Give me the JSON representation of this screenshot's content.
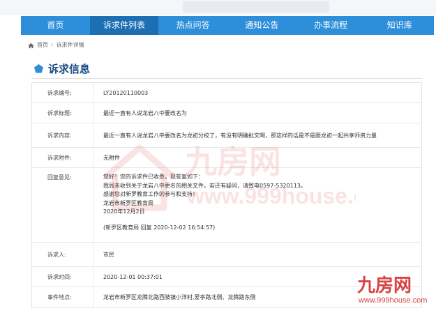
{
  "nav": {
    "items": [
      "首页",
      "诉求件列表",
      "热点问答",
      "通知公告",
      "办事流程",
      "知识库"
    ],
    "active_index": 1
  },
  "breadcrumb": {
    "home": "首页",
    "current": "诉求件详情"
  },
  "section_title": "诉求信息",
  "fields": {
    "code_label": "诉求编号:",
    "code_value": "LY20120110003",
    "title_label": "诉求标题:",
    "title_value": "最近一直有人说龙岩八中要改名为",
    "content_label": "诉求内容:",
    "content_value": "最近一直有人说龙岩八中要改名为龙初分校了，有没有明确批文啊，那这样的话是不是跟龙初一起共享师资力量",
    "attach_label": "诉求附件:",
    "attach_value": "无附件",
    "reply_label": "回复意见:",
    "reply_lines": [
      "您好！您的诉求件已收悉，现答复如下：",
      "我局未收到关于龙岩八中更名的相关文件。若还有疑问，请致电0597-5320113。",
      "感谢您对新罗教育工作的参与和支持！",
      "龙岩市新罗区教育局",
      "2020年12月2日"
    ],
    "reply_sign": "(新罗区教育局 回复 2020-12-02 16:54:57)",
    "person_label": "诉求人:",
    "person_value": "市民",
    "time_label": "诉求时间:",
    "time_value": "2020-12-01 00:37:01",
    "place_label": "事件地点:",
    "place_value": "龙岩市新罗区龙腾北路西陂镇小洋村,爱亭路北侧、龙腾路东侧"
  },
  "watermark": {
    "brand_cn": "九房网",
    "brand_en": "www.999house.com"
  },
  "colors": {
    "nav_bg": "#2d8ed9",
    "nav_active": "#1d6fb4",
    "title": "#1a4c84",
    "watermark": "#d94244"
  }
}
